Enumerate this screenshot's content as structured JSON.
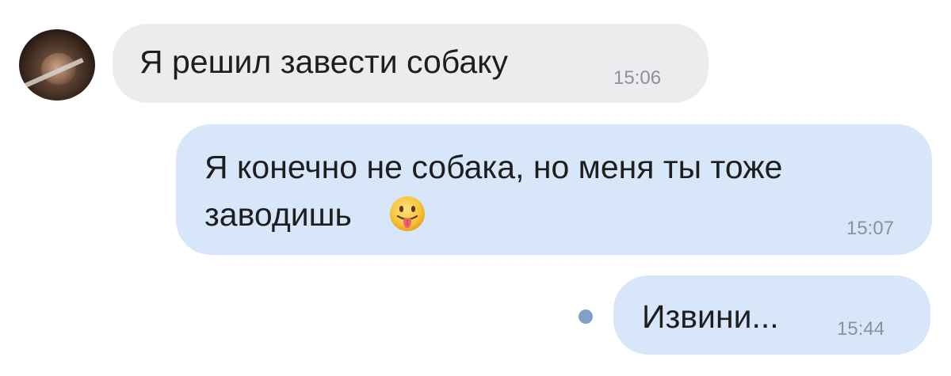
{
  "messages": [
    {
      "direction": "incoming",
      "text": "Я решил завести собаку",
      "time": "15:06"
    },
    {
      "direction": "outgoing",
      "line1": "Я конечно не собака, но меня ты тоже",
      "line2": "заводишь",
      "emoji": "face-with-tongue-icon",
      "time": "15:07"
    },
    {
      "direction": "outgoing",
      "text": "Извини...",
      "time": "15:44",
      "status": "unread"
    }
  ],
  "colors": {
    "incoming_bubble": "#ececef",
    "outgoing_bubble": "#d8e6fa",
    "timestamp": "#8c9099",
    "unread_dot": "#7f9fc6"
  }
}
